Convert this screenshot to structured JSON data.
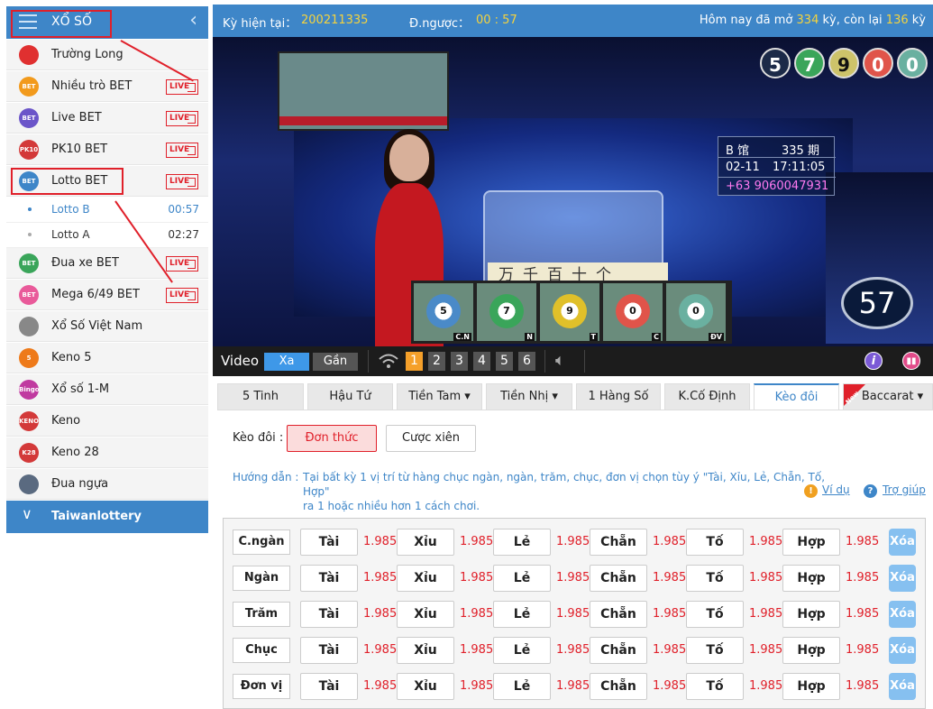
{
  "sidebar": {
    "title": "XỔ SỐ",
    "items": [
      {
        "label": "Trường Long",
        "icon": "chart-up-icon",
        "icon_text": "",
        "color": "#e03030",
        "live": false
      },
      {
        "label": "Nhiều trò BET",
        "icon": "bet-multi-icon",
        "icon_text": "BET",
        "color": "#f29a1c",
        "live": true
      },
      {
        "label": "Live BET",
        "icon": "bet-live-icon",
        "icon_text": "BET",
        "color": "#6b55c9",
        "live": true
      },
      {
        "label": "PK10 BET",
        "icon": "bet-pk10-icon",
        "icon_text": "PK10",
        "color": "#d33939",
        "live": true
      },
      {
        "label": "Lotto BET",
        "icon": "bet-lotto-icon",
        "icon_text": "BET",
        "color": "#3e86c8",
        "live": true
      },
      {
        "label": "Đua xe BET",
        "icon": "bet-race-icon",
        "icon_text": "BET",
        "color": "#3aa55a",
        "live": true
      },
      {
        "label": "Mega 6/49 BET",
        "icon": "bet-mega-icon",
        "icon_text": "BET",
        "color": "#e95a9a",
        "live": true
      },
      {
        "label": "Xổ Số Việt Nam",
        "icon": "vn-lottery-icon",
        "icon_text": "",
        "color": "#888888",
        "live": false
      },
      {
        "label": "Keno 5",
        "icon": "keno5-icon",
        "icon_text": "5",
        "color": "#ee7a1a",
        "live": false
      },
      {
        "label": "Xổ số 1-M",
        "icon": "bingo-icon",
        "icon_text": "Bingo",
        "color": "#c03aa0",
        "live": false
      },
      {
        "label": "Keno",
        "icon": "keno-icon",
        "icon_text": "KENO",
        "color": "#d33939",
        "live": false
      },
      {
        "label": "Keno 28",
        "icon": "keno28-icon",
        "icon_text": "K28",
        "color": "#d33939",
        "live": false
      },
      {
        "label": "Đua ngựa",
        "icon": "horse-icon",
        "icon_text": "",
        "color": "#5a6a80",
        "live": false
      }
    ],
    "live_label": "LIVE",
    "sub_items": [
      {
        "label": "Lotto B",
        "time": "00:57",
        "active": true
      },
      {
        "label": "Lotto A",
        "time": "02:27",
        "active": false
      }
    ],
    "footer": "Taiwanlottery"
  },
  "info_bar": {
    "period_label": "Kỳ hiện tại：",
    "period_value": "200211335",
    "countdown_label": "Đ.ngược：",
    "countdown_value": "00 : 57",
    "today_prefix": "Hôm nay đã mở",
    "today_open": "334",
    "today_mid": "kỳ, còn lại",
    "today_left": "136",
    "today_suffix": "kỳ"
  },
  "video": {
    "balls": [
      {
        "n": "5",
        "color": "#1c2a48",
        "text_color": "#ffffff"
      },
      {
        "n": "7",
        "color": "#3aa55a",
        "text_color": "#ffffff"
      },
      {
        "n": "9",
        "color": "#cdc36a",
        "text_color": "#111111"
      },
      {
        "n": "0",
        "color": "#e0544a",
        "text_color": "#ffffff"
      },
      {
        "n": "0",
        "color": "#6ab0a0",
        "text_color": "#ffffff"
      }
    ],
    "panel_hall": "B 馆",
    "panel_period": "335 期",
    "panel_date": "02-11",
    "panel_time": "17:11:05",
    "panel_phone": "+63 9060047931",
    "cn_chars": "万千百十个",
    "tiles": [
      {
        "tag": "C.N",
        "n": "5",
        "color": "#4a8ac8"
      },
      {
        "tag": "N",
        "n": "7",
        "color": "#3aa55a"
      },
      {
        "tag": "T",
        "n": "9",
        "color": "#e0c02a"
      },
      {
        "tag": "C",
        "n": "0",
        "color": "#e0544a"
      },
      {
        "tag": "ĐV",
        "n": "0",
        "color": "#6ab0a0"
      }
    ],
    "countdown": "57"
  },
  "controls": {
    "video_label": "Video",
    "far_label": "Xa",
    "near_label": "Gần",
    "channels": [
      "1",
      "2",
      "3",
      "4",
      "5",
      "6"
    ]
  },
  "tabs": [
    {
      "label": "5 Tinh",
      "dropdown": false
    },
    {
      "label": "Hậu Tứ",
      "dropdown": false
    },
    {
      "label": "Tiền Tam",
      "dropdown": true
    },
    {
      "label": "Tiền Nhị",
      "dropdown": true
    },
    {
      "label": "1 Hàng Số",
      "dropdown": false
    },
    {
      "label": "K.Cố Định",
      "dropdown": false
    },
    {
      "label": "Kèo đôi",
      "dropdown": false,
      "active": true
    },
    {
      "label": "Baccarat",
      "dropdown": true,
      "badge": "New"
    }
  ],
  "bet_mode": {
    "label": "Kèo đôi :",
    "single": "Đơn thức",
    "combo": "Cược xiên"
  },
  "guide": {
    "label": "Hướng dẫn :",
    "line1": "Tại bất kỳ 1 vị trí từ hàng chục ngàn, ngàn, trăm, chục, đơn vị chọn tùy ý \"Tài, Xỉu, Lẻ, Chẵn, Tố, Hợp\"",
    "line2": "ra 1 hoặc nhiều hơn 1 cách chơi.",
    "example": "Ví dụ",
    "help": "Trợ giúp"
  },
  "grid": {
    "rows": [
      "C.ngàn",
      "Ngàn",
      "Trăm",
      "Chục",
      "Đơn vị"
    ],
    "options": [
      "Tài",
      "Xỉu",
      "Lẻ",
      "Chẵn",
      "Tố",
      "Hợp"
    ],
    "odds": "1.985",
    "clear": "Xóa"
  },
  "colors": {
    "primary": "#3e86c8",
    "accent_yellow": "#f5d33d",
    "odds_red": "#e0202a"
  }
}
